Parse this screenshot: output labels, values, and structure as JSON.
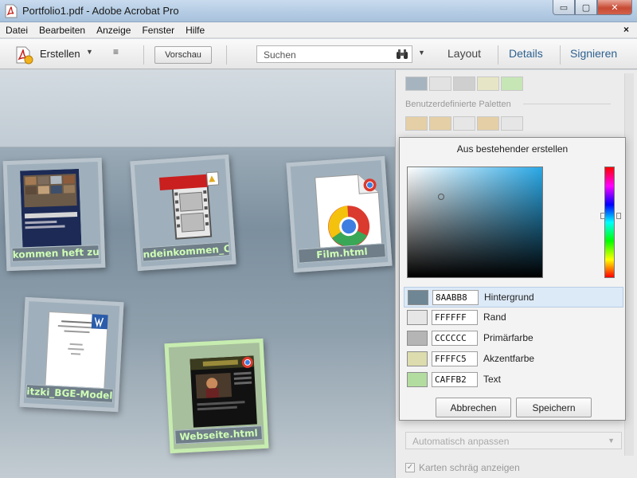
{
  "window": {
    "title": "Portfolio1.pdf - Adobe Acrobat Pro",
    "minimize_glyph": "▭",
    "maximize_glyph": "▢",
    "close_glyph": "✕"
  },
  "menu": {
    "items": [
      "Datei",
      "Bearbeiten",
      "Anzeige",
      "Fenster",
      "Hilfe"
    ],
    "close_glyph": "×"
  },
  "toolbar": {
    "create_label": "Erstellen",
    "options_glyph": "≡",
    "preview_label": "Vorschau",
    "search_placeholder": "Suchen",
    "tabs": [
      "Layout",
      "Details",
      "Signieren"
    ]
  },
  "cards": [
    {
      "label": "kommen heft zun",
      "thumb": "magazine-thumbnail",
      "selected": false
    },
    {
      "label": "ndeinkommen_Clip.f",
      "thumb": "video-clip-thumbnail",
      "selected": false
    },
    {
      "label": "Film.html",
      "thumb": "chrome-html-thumbnail",
      "selected": false
    },
    {
      "label": "itzki_BGE-Modell-",
      "thumb": "word-document-thumbnail",
      "selected": false
    },
    {
      "label": "Webseite.html",
      "thumb": "website-thumbnail",
      "selected": true
    }
  ],
  "right_panel": {
    "section_label": "Benutzerdefinierte Paletten",
    "select_value": "Automatisch anpassen",
    "checkbox_label": "Karten schräg anzeigen",
    "checkbox_checked": true,
    "palette_row1": [
      "#a6b4bf",
      "#e2e2e2",
      "#cfcfcf",
      "#e6e6c6",
      "#c6e6b6"
    ],
    "palette_row2": [
      "#e5cfa6",
      "#e5cfa6",
      "#e6e6e6",
      "#e5cfa6",
      "#e6e6e6"
    ]
  },
  "dialog": {
    "title": "Aus bestehender erstellen",
    "colors": [
      {
        "hex": "8AABB8",
        "name": "Hintergrund",
        "swatch": "#6f8695",
        "active": true
      },
      {
        "hex": "FFFFFF",
        "name": "Rand",
        "swatch": "#e6e6e6",
        "active": false
      },
      {
        "hex": "CCCCCC",
        "name": "Primärfarbe",
        "swatch": "#b5b5b5",
        "active": false
      },
      {
        "hex": "FFFFC5",
        "name": "Akzentfarbe",
        "swatch": "#dcdcae",
        "active": false
      },
      {
        "hex": "CAFFB2",
        "name": "Text",
        "swatch": "#b3dca0",
        "active": false
      }
    ],
    "cancel_label": "Abbrechen",
    "save_label": "Speichern"
  }
}
